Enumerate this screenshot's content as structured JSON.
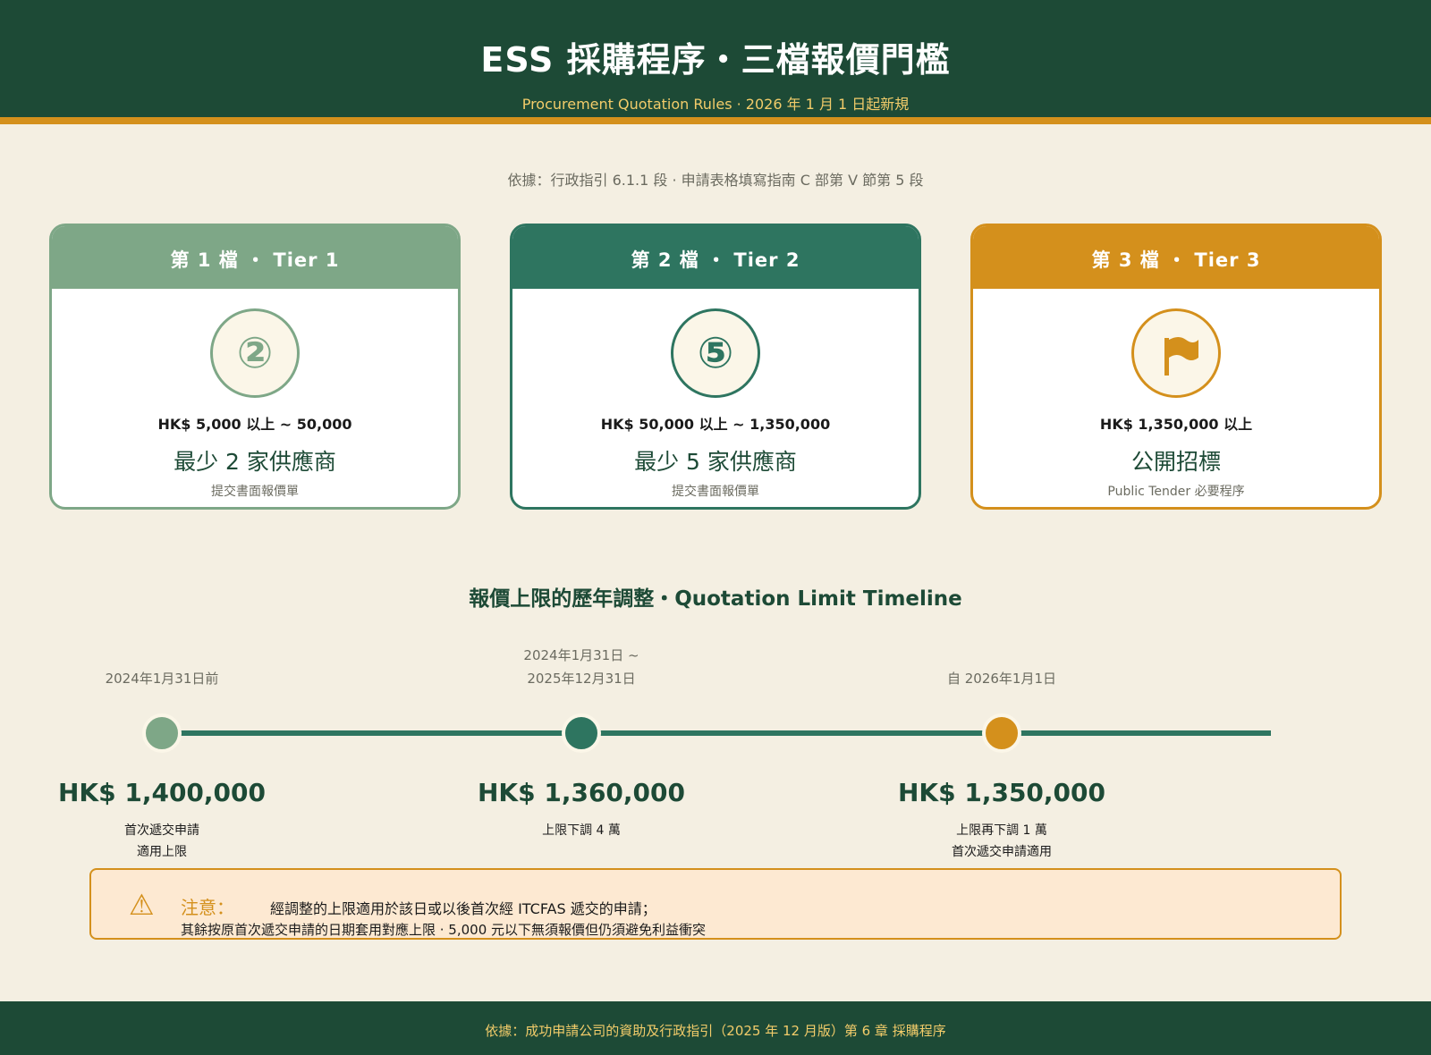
{
  "header": {
    "title": "ESS 採購程序・三檔報價門檻",
    "subtitle": "Procurement Quotation Rules · 2026 年 1 月 1 日起新規"
  },
  "basis": "依據：行政指引 6.1.1 段 · 申請表格填寫指南 C 部第 V 節第 5 段",
  "tiers": [
    {
      "head": "第 1 檔 ・ Tier 1",
      "badge": "②",
      "range": "HK$ 5,000 以上 ~ 50,000",
      "requirement": "最少 2 家供應商",
      "note": "提交書面報價單",
      "color": "#7ea787"
    },
    {
      "head": "第 2 檔 ・ Tier 2",
      "badge": "⑤",
      "range": "HK$ 50,000 以上 ~ 1,350,000",
      "requirement": "最少 5 家供應商",
      "note": "提交書面報價單",
      "color": "#2e7560"
    },
    {
      "head": "第 3 檔 ・ Tier 3",
      "badge_icon": "flag-icon",
      "range": "HK$ 1,350,000 以上",
      "requirement": "公開招標",
      "note": "Public Tender 必要程序",
      "color": "#d4901c"
    }
  ],
  "timeline": {
    "title": "報價上限的歷年調整・Quotation Limit Timeline",
    "items": [
      {
        "date_lines": [
          "2024年1月31日前"
        ],
        "amount": "HK$ 1,400,000",
        "note_lines": [
          "首次遞交申請",
          "適用上限"
        ],
        "color": "#7ea787"
      },
      {
        "date_lines": [
          "2024年1月31日 ~",
          "2025年12月31日"
        ],
        "amount": "HK$ 1,360,000",
        "note_lines": [
          "上限下調 4 萬"
        ],
        "color": "#2e7560"
      },
      {
        "date_lines": [
          "自 2026年1月1日"
        ],
        "amount": "HK$ 1,350,000",
        "note_lines": [
          "上限再下調 1 萬",
          "首次遞交申請適用"
        ],
        "color": "#d4901c"
      }
    ]
  },
  "alert": {
    "icon": "warning-icon",
    "label": "注意：",
    "line1": "經調整的上限適用於該日或以後首次經 ITCFAS 遞交的申請；",
    "line2": "其餘按原首次遞交申請的日期套用對應上限 · 5,000 元以下無須報價但仍須避免利益衝突"
  },
  "footer": "依據：成功申請公司的資助及行政指引（2025 年 12 月版）第 6 章 採購程序",
  "colors": {
    "primary": "#1d4a36",
    "accent": "#d4901c",
    "background": "#f4efe2"
  }
}
